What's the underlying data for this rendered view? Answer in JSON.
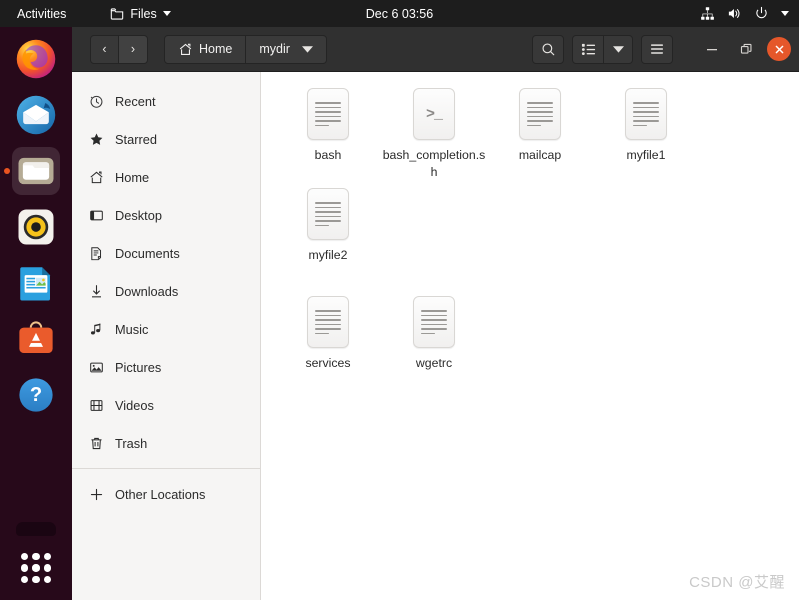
{
  "topbar": {
    "activities": "Activities",
    "app_menu": {
      "label": "Files",
      "icon": "folder-icon",
      "chevron": "chevron-down-icon"
    },
    "clock": "Dec 6  03:56",
    "status_icons": [
      "network-wired-icon",
      "volume-icon",
      "power-icon",
      "chevron-down-icon"
    ]
  },
  "dock": {
    "items": [
      {
        "name": "firefox",
        "label": "Firefox",
        "active": false
      },
      {
        "name": "thunderbird",
        "label": "Thunderbird",
        "active": false
      },
      {
        "name": "files",
        "label": "Files",
        "active": true
      },
      {
        "name": "rhythmbox",
        "label": "Rhythmbox",
        "active": false
      },
      {
        "name": "libreoffice-writer",
        "label": "LibreOffice Writer",
        "active": false
      },
      {
        "name": "ubuntu-software",
        "label": "Ubuntu Software",
        "active": false
      },
      {
        "name": "help",
        "label": "Help",
        "active": false
      }
    ],
    "show_apps": "show-applications"
  },
  "window": {
    "headerbar": {
      "back": "‹",
      "forward": "›",
      "breadcrumb": [
        {
          "label": "Home",
          "icon": "home-icon"
        },
        {
          "label": "mydir",
          "icon": "chevron-down-icon"
        }
      ],
      "search": "search-icon",
      "view_toggle": "list-view-icon",
      "view_dropdown": "chevron-down-icon",
      "menu": "hamburger-menu-icon",
      "minimize": "–",
      "maximize": "❐",
      "close": "×",
      "close_color": "#e5572a"
    },
    "sidebar": {
      "items": [
        {
          "label": "Recent",
          "icon": "clock-icon"
        },
        {
          "label": "Starred",
          "icon": "star-icon"
        },
        {
          "label": "Home",
          "icon": "home-icon"
        },
        {
          "label": "Desktop",
          "icon": "desktop-icon"
        },
        {
          "label": "Documents",
          "icon": "document-icon"
        },
        {
          "label": "Downloads",
          "icon": "download-icon"
        },
        {
          "label": "Music",
          "icon": "music-note-icon"
        },
        {
          "label": "Pictures",
          "icon": "picture-icon"
        },
        {
          "label": "Videos",
          "icon": "video-icon"
        },
        {
          "label": "Trash",
          "icon": "trash-icon"
        }
      ],
      "other_locations": {
        "label": "Other Locations",
        "icon": "plus-icon"
      }
    },
    "files": [
      {
        "name": "bash",
        "type": "text"
      },
      {
        "name": "bash_completion.sh",
        "type": "script"
      },
      {
        "name": "mailcap",
        "type": "text"
      },
      {
        "name": "myfile1",
        "type": "text"
      },
      {
        "name": "myfile2",
        "type": "text"
      },
      {
        "name": "services",
        "type": "text"
      },
      {
        "name": "wgetrc",
        "type": "text"
      }
    ]
  },
  "watermark": "CSDN @艾醒"
}
